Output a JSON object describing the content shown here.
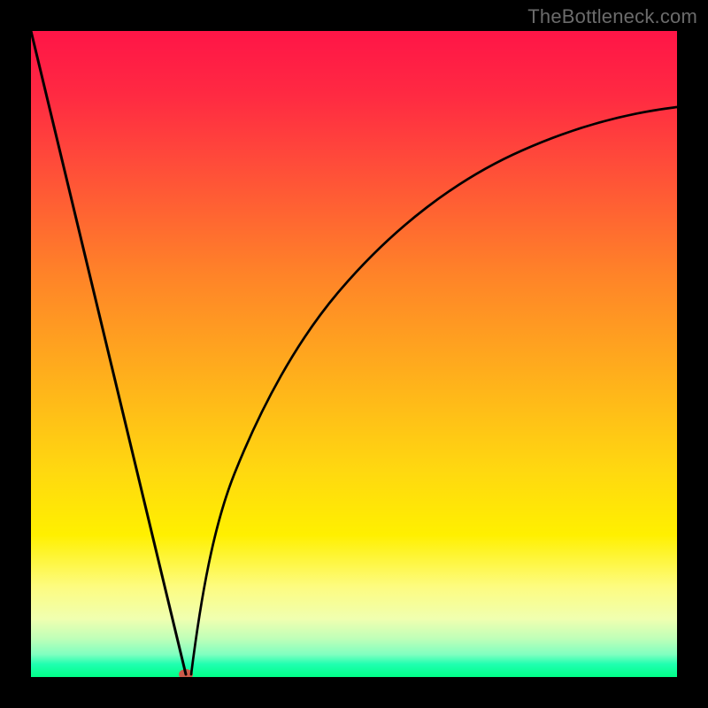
{
  "watermark": "TheBottleneck.com",
  "chart_data": {
    "type": "line",
    "title": "",
    "xlabel": "",
    "ylabel": "",
    "xlim": [
      0,
      100
    ],
    "ylim": [
      0,
      100
    ],
    "series": [
      {
        "name": "curve",
        "x": [
          0,
          5,
          10,
          15,
          20,
          24,
          25,
          26,
          30,
          35,
          40,
          45,
          50,
          55,
          60,
          65,
          70,
          75,
          80,
          85,
          90,
          95,
          100
        ],
        "y": [
          100,
          79,
          58,
          37,
          16,
          0,
          0,
          2,
          16,
          31,
          43,
          53,
          61,
          67,
          72,
          76,
          79,
          81.5,
          83.5,
          85,
          86,
          87,
          88
        ]
      }
    ],
    "marker": {
      "x": 24,
      "y": 0,
      "color": "#cc5b4a"
    },
    "gradient": {
      "top": "#ff1547",
      "mid_high": "#ffa020",
      "mid": "#fff000",
      "mid_low": "#fdfc80",
      "bottom": "#00ff88"
    }
  }
}
